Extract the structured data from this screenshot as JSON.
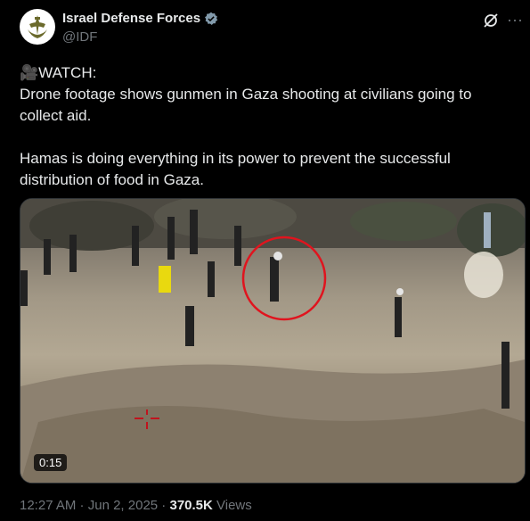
{
  "author": {
    "display_name": "Israel Defense Forces",
    "handle": "@IDF"
  },
  "icons": {
    "avatar": "idf-emblem-icon",
    "verified": "verified-badge-icon",
    "grok": "grok-icon",
    "more": "more-options-icon",
    "camera": "movie-camera-icon"
  },
  "tweet": {
    "line1": "🎥WATCH:",
    "line2": "Drone footage shows gunmen in Gaza shooting at civilians going to collect aid.",
    "line3": "Hamas is doing everything in its power to prevent the successful distribution of food in Gaza."
  },
  "media": {
    "duration": "0:15"
  },
  "meta": {
    "time": "12:27 AM",
    "sep1": " · ",
    "date": "Jun 2, 2025",
    "sep2": " · ",
    "views_count": "370.5K",
    "views_label": " Views"
  },
  "colors": {
    "highlight_circle": "#e0141e",
    "verified": "#829aab"
  }
}
